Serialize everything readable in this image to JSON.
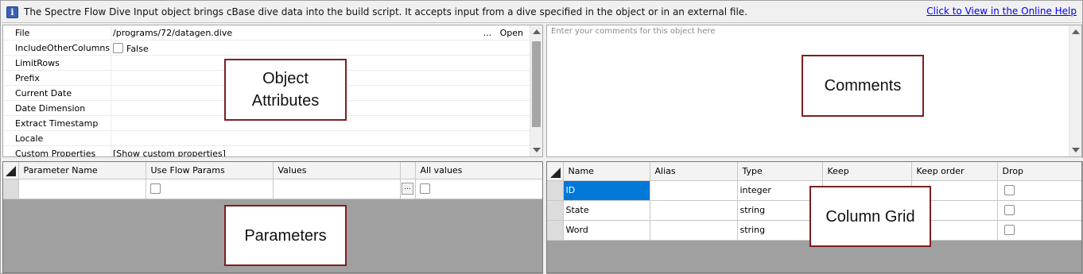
{
  "info_bar": {
    "icon": "info-icon",
    "message": "The Spectre Flow Dive Input object brings cBase dive data into the build script. It accepts input from a dive specified in the object or in an external file.",
    "help_link": "Click to View in the Online Help"
  },
  "properties": [
    {
      "name": "File",
      "value": "/programs/72/datagen.dive",
      "action_ellipsis": "...",
      "action_open": "Open"
    },
    {
      "name": "IncludeOtherColumns",
      "value": "False"
    },
    {
      "name": "LimitRows",
      "value": ""
    },
    {
      "name": "Prefix",
      "value": ""
    },
    {
      "name": "Current Date",
      "value": ""
    },
    {
      "name": "Date Dimension",
      "value": ""
    },
    {
      "name": "Extract Timestamp",
      "value": ""
    },
    {
      "name": "Locale",
      "value": ""
    },
    {
      "name": "Custom Properties",
      "value": "[Show custom properties]"
    }
  ],
  "comments": {
    "placeholder": "Enter your comments for this object here"
  },
  "parameters_grid": {
    "columns": [
      "Parameter Name",
      "Use Flow Params",
      "Values",
      "",
      "All values"
    ],
    "ellipsis": "..."
  },
  "column_grid": {
    "columns": [
      "Name",
      "Alias",
      "Type",
      "Keep",
      "Keep order",
      "Drop"
    ],
    "rows": [
      {
        "name": "ID",
        "alias": "",
        "type": "integer"
      },
      {
        "name": "State",
        "alias": "",
        "type": "string"
      },
      {
        "name": "Word",
        "alias": "",
        "type": "string"
      }
    ]
  },
  "annotations": {
    "object_attributes": "Object Attributes",
    "comments": "Comments",
    "parameters": "Parameters",
    "column_grid": "Column Grid"
  },
  "colors": {
    "selection": "#0078d7",
    "annotation_border": "#7f1f1f",
    "link": "#0000ee"
  }
}
